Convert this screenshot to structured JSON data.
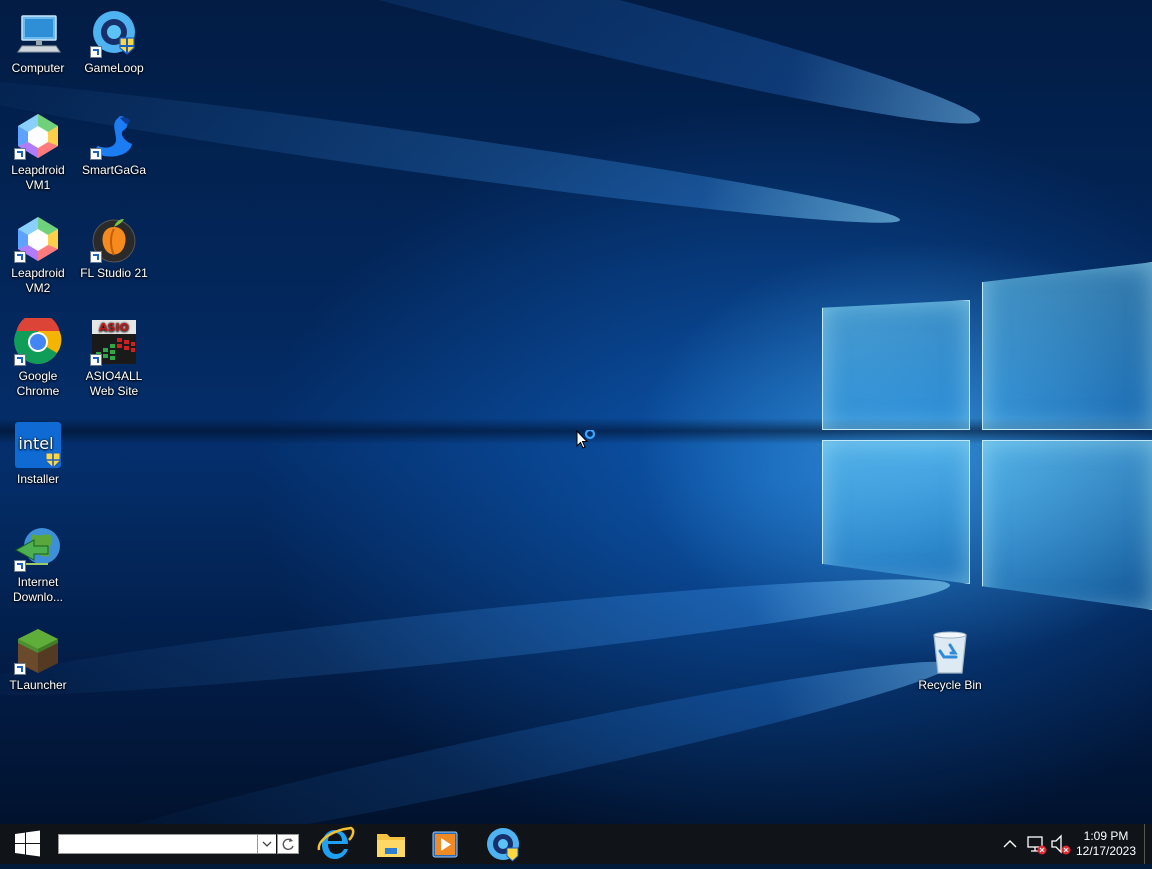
{
  "desktop": {
    "icons": [
      {
        "label": "Computer",
        "icon": "computer-icon"
      },
      {
        "label": "GameLoop",
        "icon": "gameloop-icon"
      },
      {
        "label": "Leapdroid VM1",
        "icon": "leapdroid-icon"
      },
      {
        "label": "SmartGaGa",
        "icon": "smartgaga-icon"
      },
      {
        "label": "Leapdroid VM2",
        "icon": "leapdroid-icon"
      },
      {
        "label": "FL Studio 21",
        "icon": "fl-studio-icon"
      },
      {
        "label": "Google Chrome",
        "icon": "chrome-icon"
      },
      {
        "label": "ASIO4ALL Web Site",
        "icon": "asio4all-icon",
        "logo_text": "ASIO"
      },
      {
        "label": "Installer",
        "icon": "intel-installer-icon",
        "logo_text": "intel"
      },
      {
        "label": "Internet Downlo...",
        "icon": "internet-download-manager-icon"
      },
      {
        "label": "TLauncher",
        "icon": "tlauncher-icon"
      },
      {
        "label": "Recycle Bin",
        "icon": "recycle-bin-icon"
      }
    ]
  },
  "taskbar": {
    "search_value": "",
    "pinned": [
      {
        "icon": "internet-explorer-icon"
      },
      {
        "icon": "file-explorer-icon"
      },
      {
        "icon": "media-player-icon"
      },
      {
        "icon": "gameloop-icon"
      }
    ],
    "tray": {
      "icons": [
        "chevron-up-icon",
        "network-disconnected-icon",
        "volume-muted-icon"
      ]
    },
    "clock": {
      "time": "1:09 PM",
      "date": "12/17/2023"
    }
  },
  "colors": {
    "taskbar_bg": "#101419",
    "desktop_accent": "#0a7ae6"
  }
}
